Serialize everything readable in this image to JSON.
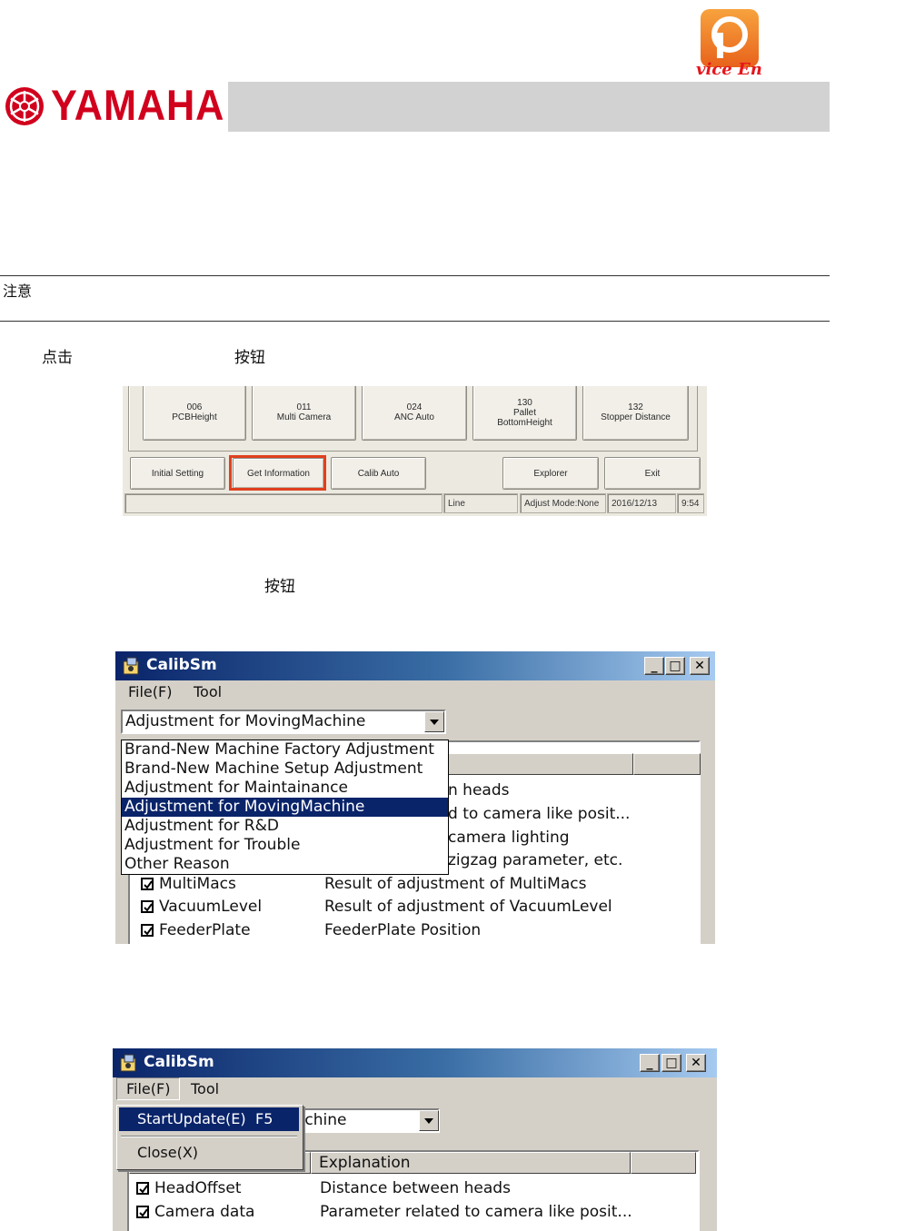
{
  "header": {
    "brand": "YAMAHA",
    "watermark": "vice  En",
    "brand_color": "#d1001d"
  },
  "note_label": "注意",
  "step1": {
    "prefix": "点击",
    "suffix": "按钮"
  },
  "step2": {
    "suffix": "按钮"
  },
  "shot1": {
    "top_buttons": [
      {
        "num": "006",
        "label": "PCBHeight"
      },
      {
        "num": "011",
        "label": "Multi Camera"
      },
      {
        "num": "024",
        "label": "ANC Auto"
      },
      {
        "num": "130",
        "label": "Pallet BottomHeight"
      },
      {
        "num": "132",
        "label": "Stopper Distance"
      }
    ],
    "bottom_buttons": [
      "Initial Setting",
      "Get Information",
      "Calib Auto",
      "Explorer",
      "Exit"
    ],
    "status": {
      "line": "Line",
      "mode": "Adjust Mode:None",
      "date": "2016/12/13",
      "time": "9:54"
    },
    "highlight_color": "#e0401e"
  },
  "shot2": {
    "title": "CalibSm",
    "menu": [
      "File(F)",
      "Tool"
    ],
    "combo_value": "Adjustment for MovingMachine",
    "dropdown_options": [
      "Brand-New Machine Factory Adjustment",
      "Brand-New Machine Setup Adjustment",
      "Adjustment for Maintainance",
      "Adjustment for MovingMachine",
      "Adjustment for R&D",
      "Adjustment for Trouble",
      "Other Reason"
    ],
    "selected_option": "Adjustment for MovingMachine",
    "partial_rows": [
      "n heads",
      "d to camera like posit...",
      "camera lighting",
      "zigzag parameter, etc."
    ],
    "rows": [
      {
        "item": "MultiMacs",
        "explanation": "Result of adjustment of MultiMacs"
      },
      {
        "item": "VacuumLevel",
        "explanation": "Result of adjustment of VacuumLevel"
      },
      {
        "item": "FeederPlate",
        "explanation": "FeederPlate Position"
      }
    ]
  },
  "shot3": {
    "title": "CalibSm",
    "menu": [
      "File(F)",
      "Tool"
    ],
    "file_menu": [
      {
        "label": "StartUpdate(E)",
        "shortcut": "F5"
      },
      {
        "label": "Close(X)",
        "shortcut": ""
      }
    ],
    "combo_value": "achine",
    "columns": [
      "Explanation"
    ],
    "rows": [
      {
        "item": "HeadOffset",
        "explanation": "Distance between heads"
      },
      {
        "item": "Camera data",
        "explanation": "Parameter related to camera like posit..."
      }
    ]
  }
}
